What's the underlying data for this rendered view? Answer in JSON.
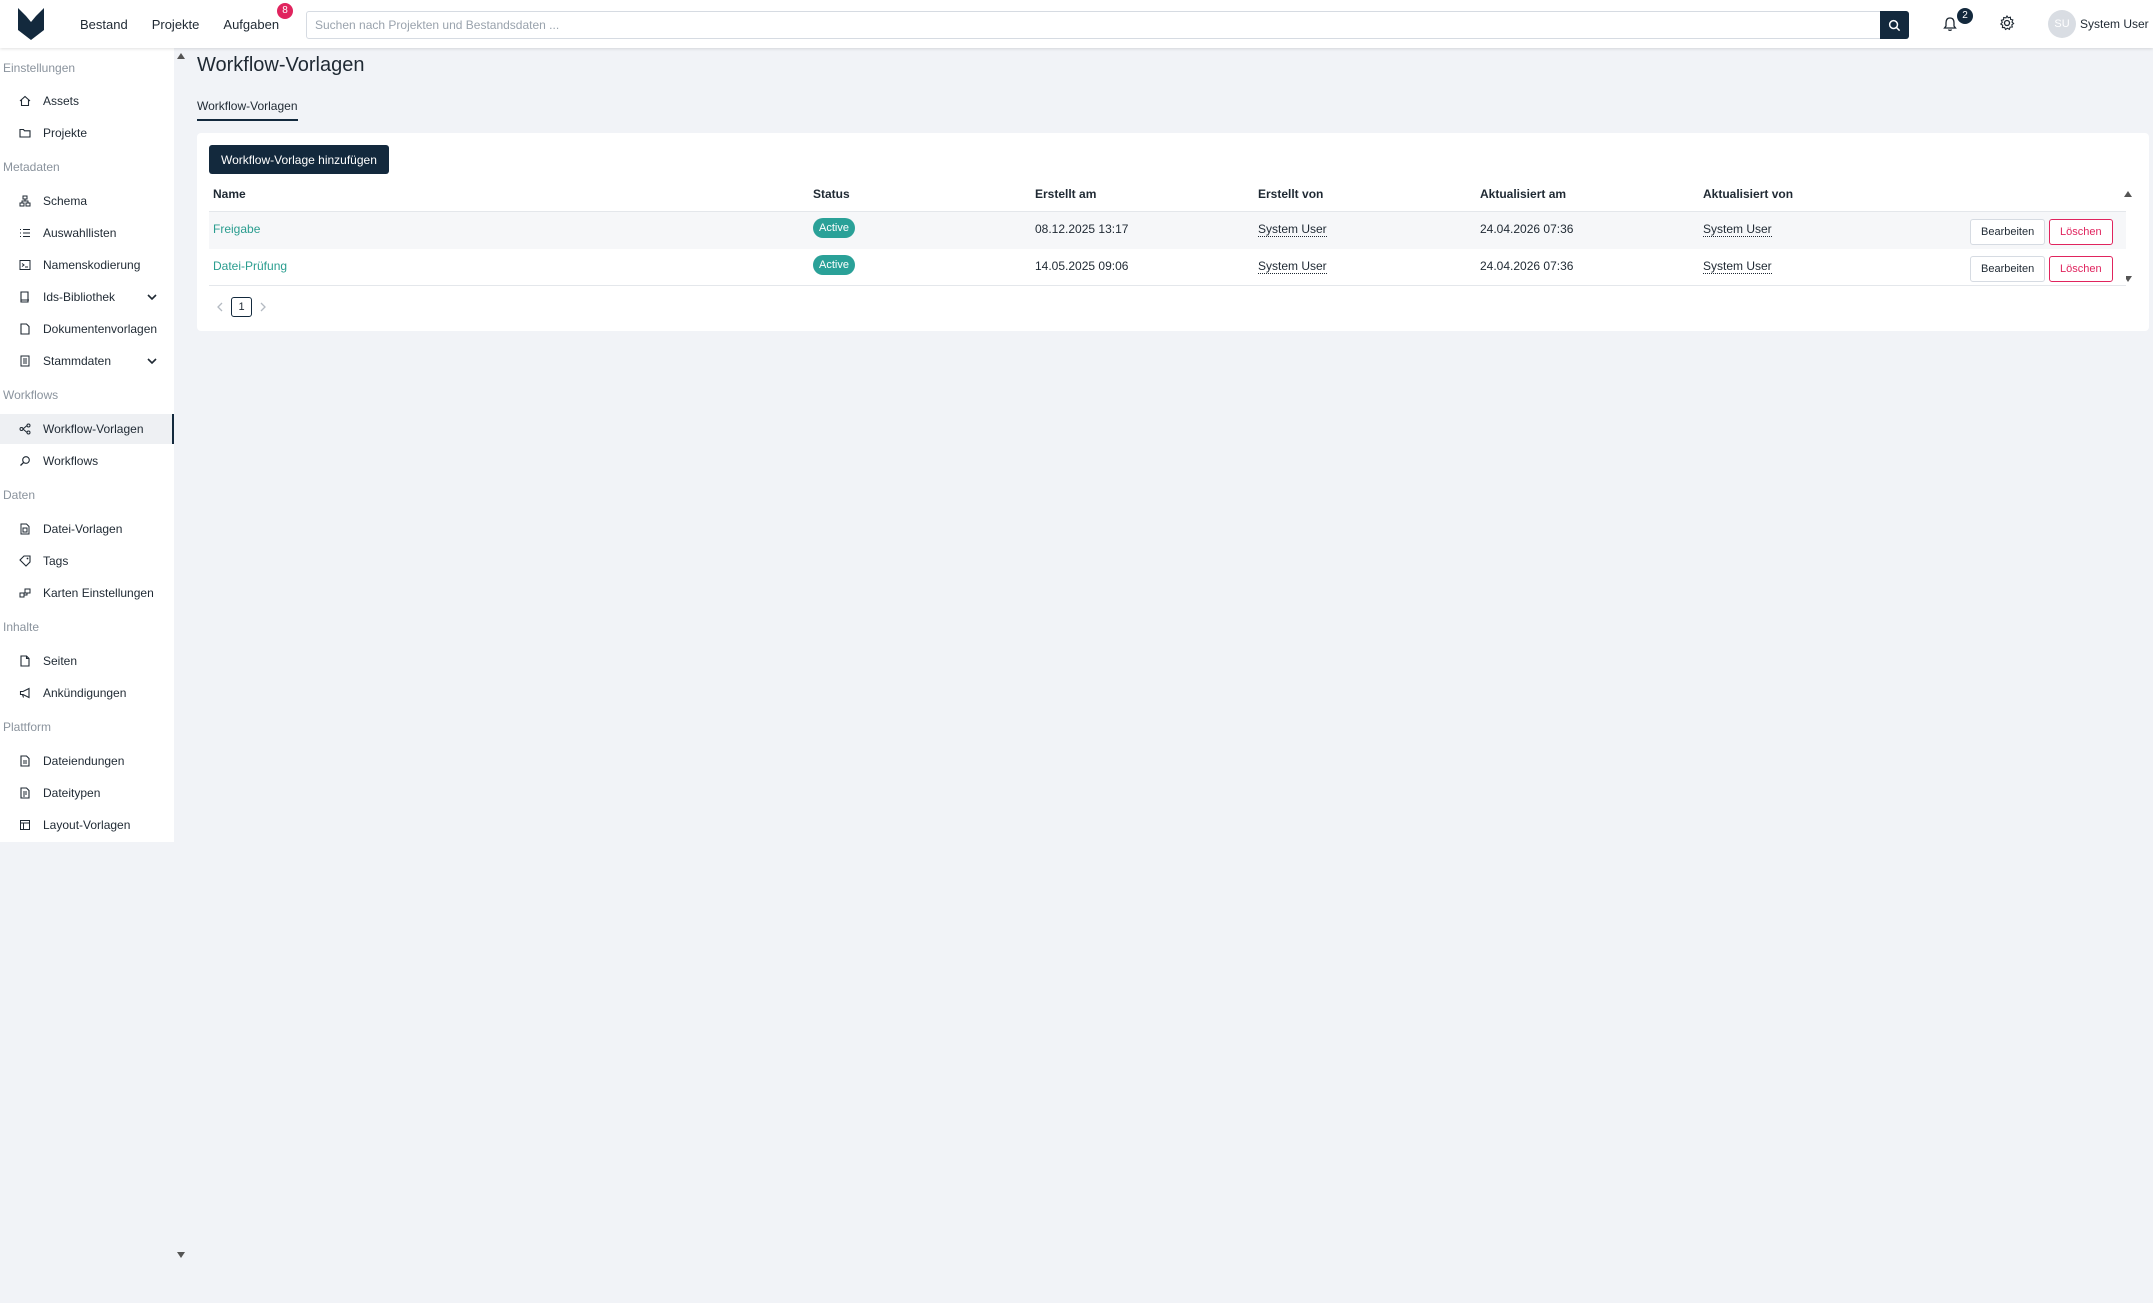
{
  "topbar": {
    "nav": [
      {
        "label": "Bestand"
      },
      {
        "label": "Projekte"
      },
      {
        "label": "Aufgaben",
        "badge": "8"
      }
    ],
    "search_placeholder": "Suchen nach Projekten und Bestandsdaten ...",
    "notifications_count": "2",
    "user_initials": "SU",
    "user_name": "System User",
    "colors": {
      "primary": "#13293d",
      "badge": "#e0245e"
    }
  },
  "sidebar": {
    "sections": [
      {
        "title": "Einstellungen",
        "items": [
          {
            "label": "Assets",
            "icon": "home-icon"
          },
          {
            "label": "Projekte",
            "icon": "folder-icon"
          }
        ]
      },
      {
        "title": "Metadaten",
        "items": [
          {
            "label": "Schema",
            "icon": "schema-icon"
          },
          {
            "label": "Auswahllisten",
            "icon": "list-icon"
          },
          {
            "label": "Namenskodierung",
            "icon": "terminal-icon"
          },
          {
            "label": "Ids-Bibliothek",
            "icon": "book-icon",
            "expandable": true
          },
          {
            "label": "Dokumentenvorlagen",
            "icon": "document-icon"
          },
          {
            "label": "Stammdaten",
            "icon": "database-icon",
            "expandable": true
          }
        ]
      },
      {
        "title": "Workflows",
        "items": [
          {
            "label": "Workflow-Vorlagen",
            "icon": "workflow-icon",
            "active": true
          },
          {
            "label": "Workflows",
            "icon": "search-icon"
          }
        ]
      },
      {
        "title": "Daten",
        "items": [
          {
            "label": "Datei-Vorlagen",
            "icon": "file-template-icon"
          },
          {
            "label": "Tags",
            "icon": "tag-icon"
          },
          {
            "label": "Karten Einstellungen",
            "icon": "map-icon"
          }
        ]
      },
      {
        "title": "Inhalte",
        "items": [
          {
            "label": "Seiten",
            "icon": "page-icon"
          },
          {
            "label": "Ankündigungen",
            "icon": "megaphone-icon"
          }
        ]
      },
      {
        "title": "Plattform",
        "items": [
          {
            "label": "Dateiendungen",
            "icon": "file-icon"
          },
          {
            "label": "Dateitypen",
            "icon": "file-type-icon"
          },
          {
            "label": "Layout-Vorlagen",
            "icon": "layout-icon"
          }
        ]
      }
    ]
  },
  "main": {
    "title": "Workflow-Vorlagen",
    "tab": "Workflow-Vorlagen",
    "add_button": "Workflow-Vorlage hinzufügen",
    "table": {
      "columns": [
        "Name",
        "Status",
        "Erstellt am",
        "Erstellt von",
        "Aktualisiert am",
        "Aktualisiert von"
      ],
      "rows": [
        {
          "name": "Freigabe",
          "status": "Active",
          "created_at": "08.12.2025 13:17",
          "created_by": "System User",
          "updated_at": "24.04.2026 07:36",
          "updated_by": "System User"
        },
        {
          "name": "Datei-Prüfung",
          "status": "Active",
          "created_at": "14.05.2025 09:06",
          "created_by": "System User",
          "updated_at": "24.04.2026 07:36",
          "updated_by": "System User"
        }
      ],
      "edit_label": "Bearbeiten",
      "delete_label": "Löschen"
    },
    "pagination": {
      "current": "1"
    }
  }
}
